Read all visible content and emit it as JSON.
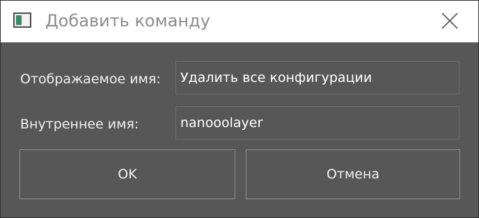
{
  "window": {
    "title": "Добавить команду",
    "close_glyph": "✕"
  },
  "form": {
    "display_name_label": "Отображаемое имя:",
    "display_name_value": "Удалить все конфигурации",
    "internal_name_label": "Внутреннее имя:",
    "internal_name_value": "nanooolayer"
  },
  "buttons": {
    "ok_label": "OK",
    "cancel_label": "Отмена"
  },
  "colors": {
    "dialog_background": "#575757",
    "titlebar_background": "#ffffff",
    "title_text": "#8c8c8c",
    "text": "#f0f0f0"
  }
}
